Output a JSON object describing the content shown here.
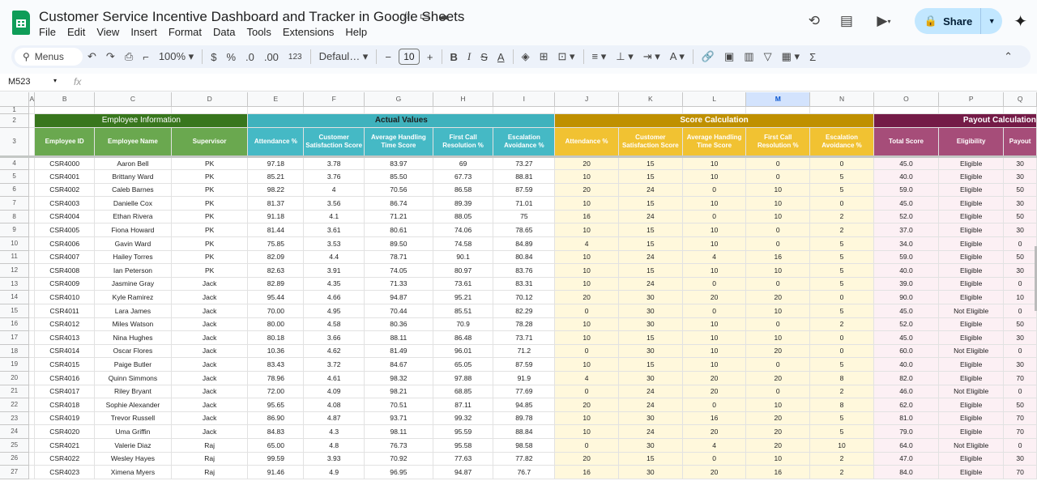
{
  "app": {
    "title": "Customer Service Incentive Dashboard and Tracker in Google Sheets",
    "menus": [
      "File",
      "Edit",
      "View",
      "Insert",
      "Format",
      "Data",
      "Tools",
      "Extensions",
      "Help"
    ],
    "share_label": "Share"
  },
  "toolbar": {
    "search": "Menus",
    "zoom": "100%",
    "currency": "$",
    "percent": "%",
    "dec_less": ".0",
    "dec_more": ".00",
    "number_format": "123",
    "font": "Defaul…",
    "font_size": "10"
  },
  "formula_bar": {
    "cell": "M523",
    "fx": "fx",
    "value": ""
  },
  "columns": [
    "A",
    "B",
    "C",
    "D",
    "E",
    "F",
    "G",
    "H",
    "I",
    "J",
    "K",
    "L",
    "M",
    "N",
    "O",
    "P",
    "Q"
  ],
  "selected_column": "M",
  "row_numbers": [
    "1",
    "2",
    "3",
    "4",
    "5",
    "6",
    "7",
    "8",
    "9",
    "10",
    "11",
    "12",
    "13",
    "14",
    "15",
    "16",
    "17",
    "18",
    "19",
    "20",
    "21",
    "22",
    "23",
    "24",
    "25",
    "26",
    "27"
  ],
  "groups": {
    "employee": "Employee Information",
    "actual": "Actual Values",
    "score": "Score Calculation",
    "payout": "Payout Calculation"
  },
  "headers": [
    "Employee ID",
    "Employee Name",
    "Supervisor",
    "Attendance %",
    "Customer Satisfaction Score",
    "Average Handling Time Score",
    "First Call Resolution %",
    "Escalation Avoidance %",
    "Attendance %",
    "Customer Satisfaction Score",
    "Average Handling Time Score",
    "First Call Resolution %",
    "Escalation Avoidance %",
    "Total Score",
    "Eligibility",
    "Payout"
  ],
  "rows": [
    [
      "CSR4000",
      "Aaron Bell",
      "PK",
      "97.18",
      "3.78",
      "83.97",
      "69",
      "73.27",
      "20",
      "15",
      "10",
      "0",
      "0",
      "45.0",
      "Eligible",
      "30"
    ],
    [
      "CSR4001",
      "Brittany Ward",
      "PK",
      "85.21",
      "3.76",
      "85.50",
      "67.73",
      "88.81",
      "10",
      "15",
      "10",
      "0",
      "5",
      "40.0",
      "Eligible",
      "30"
    ],
    [
      "CSR4002",
      "Caleb Barnes",
      "PK",
      "98.22",
      "4",
      "70.56",
      "86.58",
      "87.59",
      "20",
      "24",
      "0",
      "10",
      "5",
      "59.0",
      "Eligible",
      "50"
    ],
    [
      "CSR4003",
      "Danielle Cox",
      "PK",
      "81.37",
      "3.56",
      "86.74",
      "89.39",
      "71.01",
      "10",
      "15",
      "10",
      "10",
      "0",
      "45.0",
      "Eligible",
      "30"
    ],
    [
      "CSR4004",
      "Ethan Rivera",
      "PK",
      "91.18",
      "4.1",
      "71.21",
      "88.05",
      "75",
      "16",
      "24",
      "0",
      "10",
      "2",
      "52.0",
      "Eligible",
      "50"
    ],
    [
      "CSR4005",
      "Fiona Howard",
      "PK",
      "81.44",
      "3.61",
      "80.61",
      "74.06",
      "78.65",
      "10",
      "15",
      "10",
      "0",
      "2",
      "37.0",
      "Eligible",
      "30"
    ],
    [
      "CSR4006",
      "Gavin Ward",
      "PK",
      "75.85",
      "3.53",
      "89.50",
      "74.58",
      "84.89",
      "4",
      "15",
      "10",
      "0",
      "5",
      "34.0",
      "Eligible",
      "0"
    ],
    [
      "CSR4007",
      "Hailey Torres",
      "PK",
      "82.09",
      "4.4",
      "78.71",
      "90.1",
      "80.84",
      "10",
      "24",
      "4",
      "16",
      "5",
      "59.0",
      "Eligible",
      "50"
    ],
    [
      "CSR4008",
      "Ian Peterson",
      "PK",
      "82.63",
      "3.91",
      "74.05",
      "80.97",
      "83.76",
      "10",
      "15",
      "10",
      "10",
      "5",
      "40.0",
      "Eligible",
      "30"
    ],
    [
      "CSR4009",
      "Jasmine Gray",
      "Jack",
      "82.89",
      "4.35",
      "71.33",
      "73.61",
      "83.31",
      "10",
      "24",
      "0",
      "0",
      "5",
      "39.0",
      "Eligible",
      "0"
    ],
    [
      "CSR4010",
      "Kyle Ramirez",
      "Jack",
      "95.44",
      "4.66",
      "94.87",
      "95.21",
      "70.12",
      "20",
      "30",
      "20",
      "20",
      "0",
      "90.0",
      "Eligible",
      "10"
    ],
    [
      "CSR4011",
      "Lara James",
      "Jack",
      "70.00",
      "4.95",
      "70.44",
      "85.51",
      "82.29",
      "0",
      "30",
      "0",
      "10",
      "5",
      "45.0",
      "Not Eligible",
      "0"
    ],
    [
      "CSR4012",
      "Miles Watson",
      "Jack",
      "80.00",
      "4.58",
      "80.36",
      "70.9",
      "78.28",
      "10",
      "30",
      "10",
      "0",
      "2",
      "52.0",
      "Eligible",
      "50"
    ],
    [
      "CSR4013",
      "Nina Hughes",
      "Jack",
      "80.18",
      "3.66",
      "88.11",
      "86.48",
      "73.71",
      "10",
      "15",
      "10",
      "10",
      "0",
      "45.0",
      "Eligible",
      "30"
    ],
    [
      "CSR4014",
      "Oscar Flores",
      "Jack",
      "10.36",
      "4.62",
      "81.49",
      "96.01",
      "71.2",
      "0",
      "30",
      "10",
      "20",
      "0",
      "60.0",
      "Not Eligible",
      "0"
    ],
    [
      "CSR4015",
      "Paige Butler",
      "Jack",
      "83.43",
      "3.72",
      "84.67",
      "65.05",
      "87.59",
      "10",
      "15",
      "10",
      "0",
      "5",
      "40.0",
      "Eligible",
      "30"
    ],
    [
      "CSR4016",
      "Quinn Simmons",
      "Jack",
      "78.96",
      "4.61",
      "98.32",
      "97.88",
      "91.9",
      "4",
      "30",
      "20",
      "20",
      "8",
      "82.0",
      "Eligible",
      "70"
    ],
    [
      "CSR4017",
      "Riley Bryant",
      "Jack",
      "72.00",
      "4.09",
      "98.21",
      "68.85",
      "77.69",
      "0",
      "24",
      "20",
      "0",
      "2",
      "46.0",
      "Not Eligible",
      "0"
    ],
    [
      "CSR4018",
      "Sophie Alexander",
      "Jack",
      "95.65",
      "4.08",
      "70.51",
      "87.11",
      "94.85",
      "20",
      "24",
      "0",
      "10",
      "8",
      "62.0",
      "Eligible",
      "50"
    ],
    [
      "CSR4019",
      "Trevor Russell",
      "Jack",
      "86.90",
      "4.87",
      "93.71",
      "99.32",
      "89.78",
      "10",
      "30",
      "16",
      "20",
      "5",
      "81.0",
      "Eligible",
      "70"
    ],
    [
      "CSR4020",
      "Uma Griffin",
      "Jack",
      "84.83",
      "4.3",
      "98.11",
      "95.59",
      "88.84",
      "10",
      "24",
      "20",
      "20",
      "5",
      "79.0",
      "Eligible",
      "70"
    ],
    [
      "CSR4021",
      "Valerie Diaz",
      "Raj",
      "65.00",
      "4.8",
      "76.73",
      "95.58",
      "98.58",
      "0",
      "30",
      "4",
      "20",
      "10",
      "64.0",
      "Not Eligible",
      "0"
    ],
    [
      "CSR4022",
      "Wesley Hayes",
      "Raj",
      "99.59",
      "3.93",
      "70.92",
      "77.63",
      "77.82",
      "20",
      "15",
      "0",
      "10",
      "2",
      "47.0",
      "Eligible",
      "30"
    ],
    [
      "CSR4023",
      "Ximena Myers",
      "Raj",
      "91.46",
      "4.9",
      "96.95",
      "94.87",
      "76.7",
      "16",
      "30",
      "20",
      "16",
      "2",
      "84.0",
      "Eligible",
      "70"
    ]
  ]
}
